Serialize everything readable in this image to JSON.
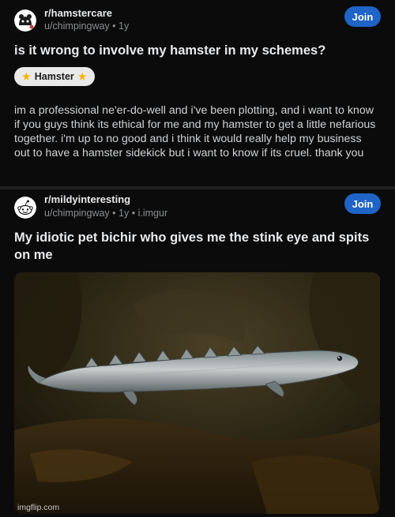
{
  "posts": [
    {
      "subreddit": "r/hamstercare",
      "author": "u/chimpingway",
      "age": "1y",
      "source": "",
      "join_label": "Join",
      "title": "is it wrong to involve my hamster in my schemes?",
      "flair": "Hamster",
      "body": "im a professional ne'er-do-well and i've been plotting, and i want to know if you guys think its ethical for me and my hamster to get a little nefarious together. i'm up to no good and i think it would really help my business out to have a hamster sidekick but i want to know if its cruel. thank you"
    },
    {
      "subreddit": "r/mildyinteresting",
      "author": "u/chimpingway",
      "age": "1y",
      "source": "i.imgur",
      "join_label": "Join",
      "title": "My idiotic pet bichir who gives me the stink eye and spits on me"
    }
  ],
  "separator": "•",
  "watermark": "imgflip.com",
  "colors": {
    "join_button": "#1f64c7",
    "background": "#0b0b0b",
    "flair_bg": "#e9e9ea",
    "flair_star": "#f5b400"
  }
}
